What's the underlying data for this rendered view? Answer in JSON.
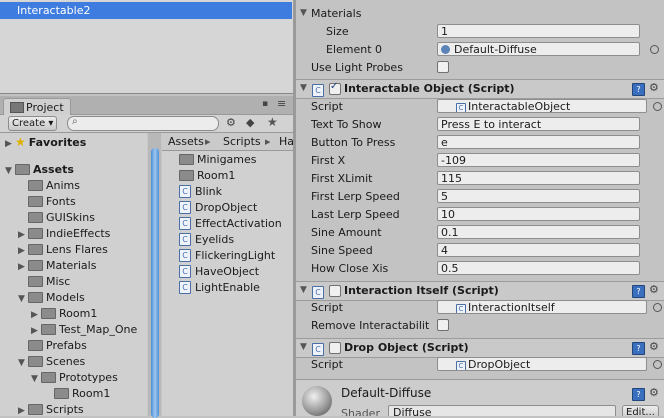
{
  "hierarchy": {
    "selected_item": "Interactable2"
  },
  "project": {
    "tab_label": "Project",
    "create_label": "Create ▾",
    "favorites_label": "Favorites",
    "assets_label": "Assets",
    "tree": [
      {
        "label": "Anims",
        "indent": 1,
        "expand": ""
      },
      {
        "label": "Fonts",
        "indent": 1,
        "expand": ""
      },
      {
        "label": "GUISkins",
        "indent": 1,
        "expand": ""
      },
      {
        "label": "IndieEffects",
        "indent": 1,
        "expand": "▶"
      },
      {
        "label": "Lens Flares",
        "indent": 1,
        "expand": "▶"
      },
      {
        "label": "Materials",
        "indent": 1,
        "expand": "▶"
      },
      {
        "label": "Misc",
        "indent": 1,
        "expand": ""
      },
      {
        "label": "Models",
        "indent": 1,
        "expand": "▼"
      },
      {
        "label": "Room1",
        "indent": 2,
        "expand": "▶"
      },
      {
        "label": "Test_Map_One",
        "indent": 2,
        "expand": "▶"
      },
      {
        "label": "Prefabs",
        "indent": 1,
        "expand": ""
      },
      {
        "label": "Scenes",
        "indent": 1,
        "expand": "▼"
      },
      {
        "label": "Prototypes",
        "indent": 2,
        "expand": "▼"
      },
      {
        "label": "Room1",
        "indent": 3,
        "expand": ""
      },
      {
        "label": "Scripts",
        "indent": 1,
        "expand": "▶"
      }
    ],
    "breadcrumb": [
      "Assets",
      "Scripts",
      "Ha"
    ],
    "files": [
      {
        "label": "Minigames",
        "kind": "folder"
      },
      {
        "label": "Room1",
        "kind": "folder"
      },
      {
        "label": "Blink",
        "kind": "script"
      },
      {
        "label": "DropObject",
        "kind": "script"
      },
      {
        "label": "EffectActivation",
        "kind": "script"
      },
      {
        "label": "Eyelids",
        "kind": "script"
      },
      {
        "label": "FlickeringLight",
        "kind": "script"
      },
      {
        "label": "HaveObject",
        "kind": "script"
      },
      {
        "label": "LightEnable",
        "kind": "script"
      }
    ]
  },
  "inspector": {
    "materials": {
      "label": "Materials",
      "size_label": "Size",
      "size_value": "1",
      "element0_label": "Element 0",
      "element0_value": "Default-Diffuse",
      "use_light_probes_label": "Use Light Probes"
    },
    "interactable_object": {
      "title": "Interactable Object (Script)",
      "fields": [
        {
          "label": "Script",
          "value": "InteractableObject",
          "type": "object"
        },
        {
          "label": "Text To Show",
          "value": "Press E to interact",
          "type": "text"
        },
        {
          "label": "Button To Press",
          "value": "e",
          "type": "text"
        },
        {
          "label": "First X",
          "value": "-109",
          "type": "text"
        },
        {
          "label": "First XLimit",
          "value": "115",
          "type": "text"
        },
        {
          "label": "First Lerp Speed",
          "value": "5",
          "type": "text"
        },
        {
          "label": "Last Lerp Speed",
          "value": "10",
          "type": "text"
        },
        {
          "label": "Sine Amount",
          "value": "0.1",
          "type": "text"
        },
        {
          "label": "Sine Speed",
          "value": "4",
          "type": "text"
        },
        {
          "label": "How Close Xis",
          "value": "0.5",
          "type": "text"
        }
      ]
    },
    "interaction_itself": {
      "title": "Interaction Itself (Script)",
      "script_label": "Script",
      "script_value": "InteractionItself",
      "remove_label": "Remove Interactabilit"
    },
    "drop_object": {
      "title": "Drop Object (Script)",
      "script_label": "Script",
      "script_value": "DropObject"
    },
    "material_footer": {
      "name": "Default-Diffuse",
      "shader_label": "Shader",
      "shader_value": "Diffuse",
      "edit_label": "Edit..."
    }
  }
}
